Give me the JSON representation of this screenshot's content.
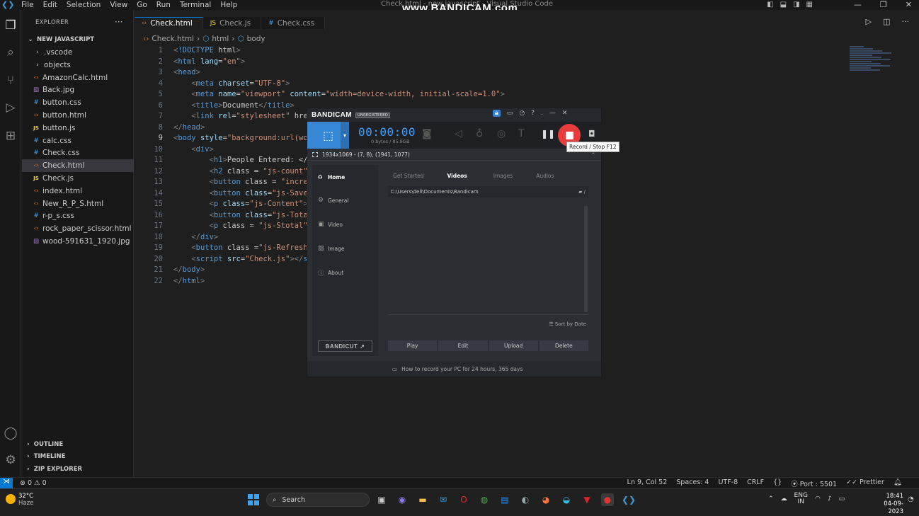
{
  "window": {
    "title": "Check.html - new javascript - Visual Studio Code",
    "watermark": "www.BANDICAM.com"
  },
  "menu": [
    "File",
    "Edit",
    "Selection",
    "View",
    "Go",
    "Run",
    "Terminal",
    "Help"
  ],
  "explorer": {
    "header": "EXPLORER",
    "folder": "NEW JAVASCRIPT",
    "items": [
      {
        "name": ".vscode",
        "type": "folder"
      },
      {
        "name": "objects",
        "type": "folder"
      },
      {
        "name": "AmazonCalc.html",
        "type": "html"
      },
      {
        "name": "Back.jpg",
        "type": "image"
      },
      {
        "name": "button.css",
        "type": "css"
      },
      {
        "name": "button.html",
        "type": "html"
      },
      {
        "name": "button.js",
        "type": "js"
      },
      {
        "name": "calc.css",
        "type": "css"
      },
      {
        "name": "Check.css",
        "type": "css"
      },
      {
        "name": "Check.html",
        "type": "html",
        "selected": true
      },
      {
        "name": "Check.js",
        "type": "js"
      },
      {
        "name": "index.html",
        "type": "html"
      },
      {
        "name": "New_R_P_S.html",
        "type": "html"
      },
      {
        "name": "r-p_s.css",
        "type": "css"
      },
      {
        "name": "rock_paper_scissor.html",
        "type": "html"
      },
      {
        "name": "wood-591631_1920.jpg",
        "type": "image"
      }
    ],
    "sections": [
      "OUTLINE",
      "TIMELINE",
      "ZIP EXPLORER"
    ]
  },
  "tabs": [
    {
      "label": "Check.html",
      "active": true,
      "type": "html"
    },
    {
      "label": "Check.js",
      "active": false,
      "type": "js"
    },
    {
      "label": "Check.css",
      "active": false,
      "type": "css"
    }
  ],
  "breadcrumb": [
    "Check.html",
    "html",
    "body"
  ],
  "code_lines": [
    "<!DOCTYPE html>",
    "<html lang=\"en\">",
    "<head>",
    "    <meta charset=\"UTF-8\">",
    "    <meta name=\"viewport\" content=\"width=device-width, initial-scale=1.0\">",
    "    <title>Document</title>",
    "    <link rel=\"stylesheet\" hre",
    "</head>",
    "<body style=\"background:url(wo",
    "    <div>",
    "        <h1>People Entered: </",
    "        <h2 class = \"js-count\"",
    "        <button class = \"incre",
    "        <button class=\"js-Save",
    "        <p class=\"js-Content\">",
    "        <button class=\"js-Tota",
    "        <p class = \"js-Stotal\"",
    "    </div>",
    "    <button class =\"js-Refresh",
    "    <script src=\"Check.js\"></sc",
    "</body>",
    "</html>"
  ],
  "current_line": 9,
  "status": {
    "problems": "0",
    "warnings": "0",
    "position": "Ln 9, Col 52",
    "spaces": "Spaces: 4",
    "encoding": "UTF-8",
    "eol": "CRLF",
    "port": "Port : 5501",
    "prettier": "Prettier"
  },
  "taskbar": {
    "temp": "32°C",
    "weather": "Haze",
    "search_placeholder": "Search",
    "lang": "ENG",
    "region": "IN",
    "time": "18:41",
    "date": "04-09-2023"
  },
  "bandicam": {
    "logo": "BANDICAM",
    "unregistered": "UNREGISTERED",
    "timer": "00:00:00",
    "size": "0 bytes / 85.8GB",
    "tooltip": "Record / Stop  F12",
    "area": "1934x1069 - (7, 8), (1941, 1077)",
    "nav": [
      "Home",
      "General",
      "Video",
      "Image",
      "About"
    ],
    "tabs": [
      "Get Started",
      "Videos",
      "Images",
      "Audios"
    ],
    "path": "C:\\Users\\dell\\Documents\\Bandicam",
    "sort": "Sort by Date",
    "actions": [
      "Play",
      "Edit",
      "Upload",
      "Delete"
    ],
    "bandicut": "BANDICUT",
    "footer": "How to record your PC for 24 hours, 365 days"
  }
}
